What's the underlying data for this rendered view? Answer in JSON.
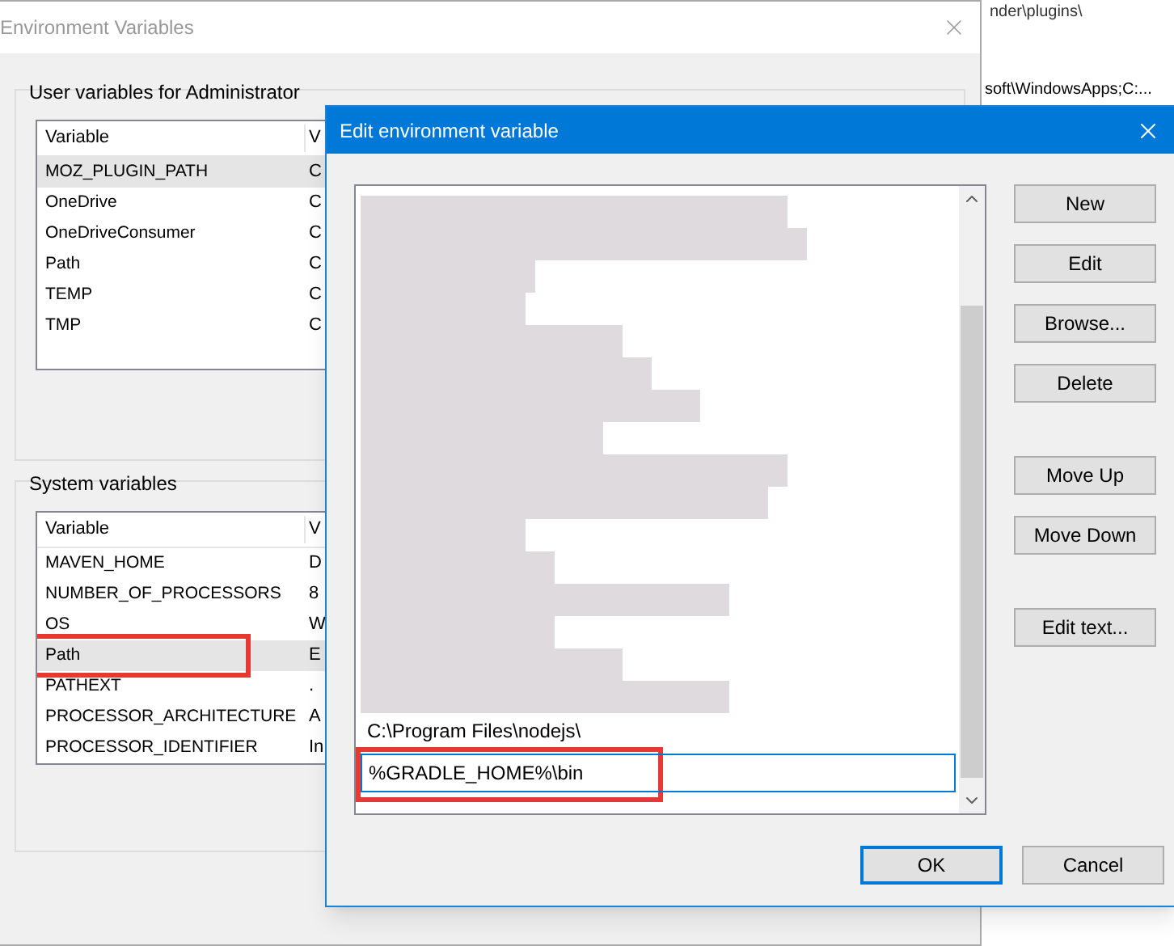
{
  "background_text": [
    "nder\\plugins\\",
    "soft\\WindowsApps;C:..."
  ],
  "env_window": {
    "title": "Environment Variables",
    "user_group": {
      "label": "User variables for Administrator",
      "columns": [
        "Variable",
        "V"
      ],
      "rows": [
        {
          "variable": "MOZ_PLUGIN_PATH",
          "value": "C",
          "selected": true,
          "highlighted": false
        },
        {
          "variable": "OneDrive",
          "value": "C",
          "selected": false,
          "highlighted": false
        },
        {
          "variable": "OneDriveConsumer",
          "value": "C",
          "selected": false,
          "highlighted": false
        },
        {
          "variable": "Path",
          "value": "C",
          "selected": false,
          "highlighted": false
        },
        {
          "variable": "TEMP",
          "value": "C",
          "selected": false,
          "highlighted": false
        },
        {
          "variable": "TMP",
          "value": "C",
          "selected": false,
          "highlighted": false
        }
      ]
    },
    "system_group": {
      "label": "System variables",
      "columns": [
        "Variable",
        "V"
      ],
      "rows": [
        {
          "variable": "MAVEN_HOME",
          "value": "D",
          "selected": false,
          "highlighted": false
        },
        {
          "variable": "NUMBER_OF_PROCESSORS",
          "value": "8",
          "selected": false,
          "highlighted": false
        },
        {
          "variable": "OS",
          "value": "W",
          "selected": false,
          "highlighted": false
        },
        {
          "variable": "Path",
          "value": "E",
          "selected": true,
          "highlighted": true
        },
        {
          "variable": "PATHEXT",
          "value": ".",
          "selected": false,
          "highlighted": false
        },
        {
          "variable": "PROCESSOR_ARCHITECTURE",
          "value": "A",
          "selected": false,
          "highlighted": false
        },
        {
          "variable": "PROCESSOR_IDENTIFIER",
          "value": "In",
          "selected": false,
          "highlighted": false
        }
      ]
    }
  },
  "edit_dialog": {
    "title": "Edit environment variable",
    "entries": [
      {
        "kind": "redacted"
      },
      {
        "kind": "redacted"
      },
      {
        "kind": "redacted"
      },
      {
        "kind": "redacted"
      },
      {
        "kind": "redacted"
      },
      {
        "kind": "redacted"
      },
      {
        "kind": "redacted"
      },
      {
        "kind": "redacted"
      },
      {
        "kind": "redacted"
      },
      {
        "kind": "redacted"
      },
      {
        "kind": "redacted"
      },
      {
        "kind": "redacted"
      },
      {
        "kind": "redacted"
      },
      {
        "kind": "redacted"
      },
      {
        "kind": "redacted"
      },
      {
        "kind": "redacted"
      },
      {
        "kind": "text",
        "text": "C:\\Program Files\\nodejs\\",
        "selected": false,
        "highlighted": false
      },
      {
        "kind": "text",
        "text": "%GRADLE_HOME%\\bin",
        "selected": true,
        "highlighted": true
      }
    ],
    "side_button_groups": [
      [
        "New",
        "Edit",
        "Browse...",
        "Delete"
      ],
      [
        "Move Up",
        "Move Down"
      ],
      [
        "Edit text..."
      ]
    ],
    "footer_buttons": [
      {
        "label": "OK",
        "default": true
      },
      {
        "label": "Cancel",
        "default": false
      }
    ]
  }
}
